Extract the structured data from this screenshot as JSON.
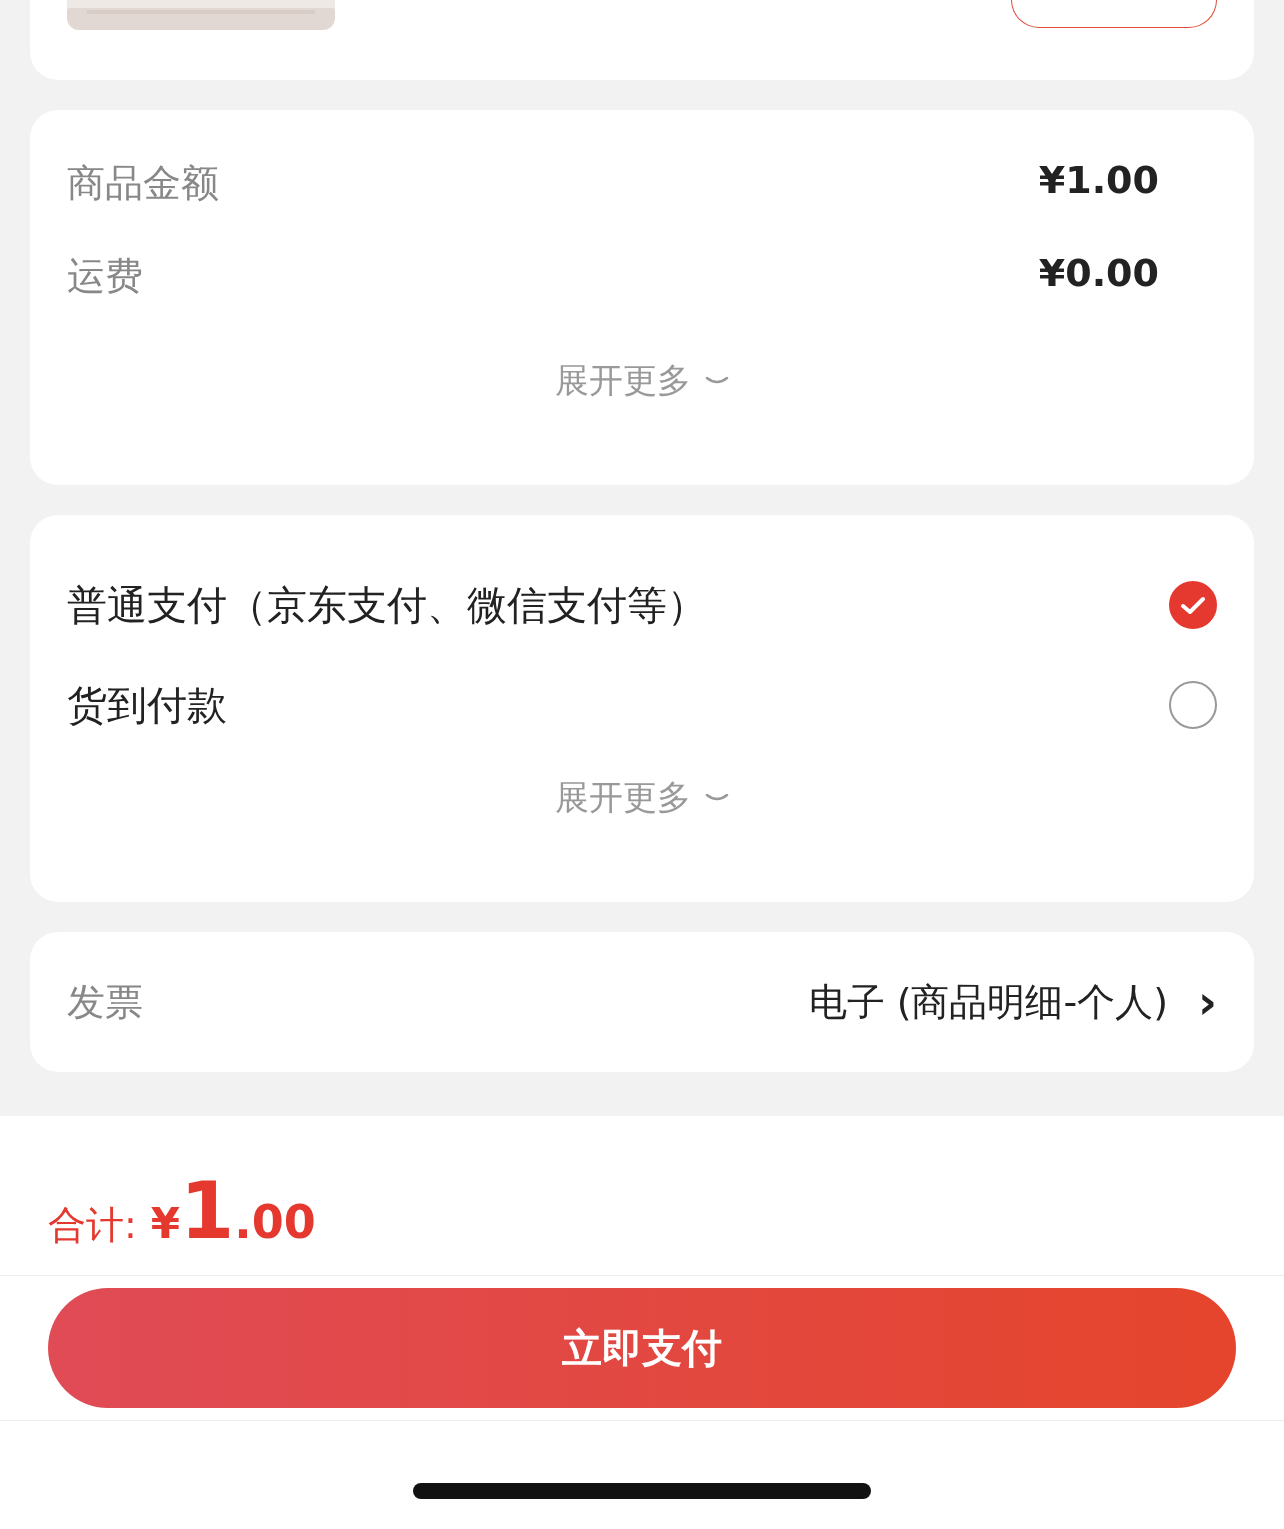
{
  "amounts": {
    "rows": [
      {
        "label": "商品金额",
        "value": "¥1.00"
      },
      {
        "label": "运费",
        "value": "¥0.00"
      }
    ],
    "expand": "展开更多"
  },
  "payment": {
    "options": [
      {
        "label": "普通支付（京东支付、微信支付等）",
        "selected": true
      },
      {
        "label": "货到付款",
        "selected": false
      }
    ],
    "expand": "展开更多"
  },
  "invoice": {
    "label": "发票",
    "value": "电子 (商品明细-个人)",
    "chevron": "›"
  },
  "total": {
    "label": "合计:",
    "currency": "¥",
    "integer": "1",
    "decimal": ".00"
  },
  "pay_button": "立即支付"
}
